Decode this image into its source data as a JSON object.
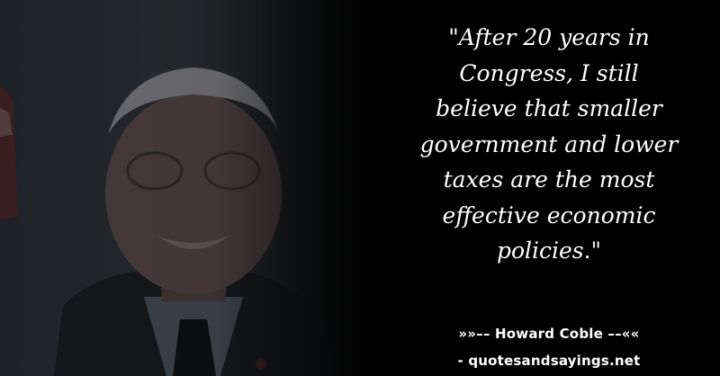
{
  "quote": {
    "text": "\"After 20 years in\nCongress, I still\nbelieve that smaller\ngovernment and lower\ntaxes are the most\neffective economic\npolicies.\""
  },
  "attribution": {
    "author_line": "»»–– Howard Coble ––««",
    "source_line": "- quotesandsayings.net"
  },
  "colors": {
    "background": "#000000",
    "text": "#ffffff"
  }
}
